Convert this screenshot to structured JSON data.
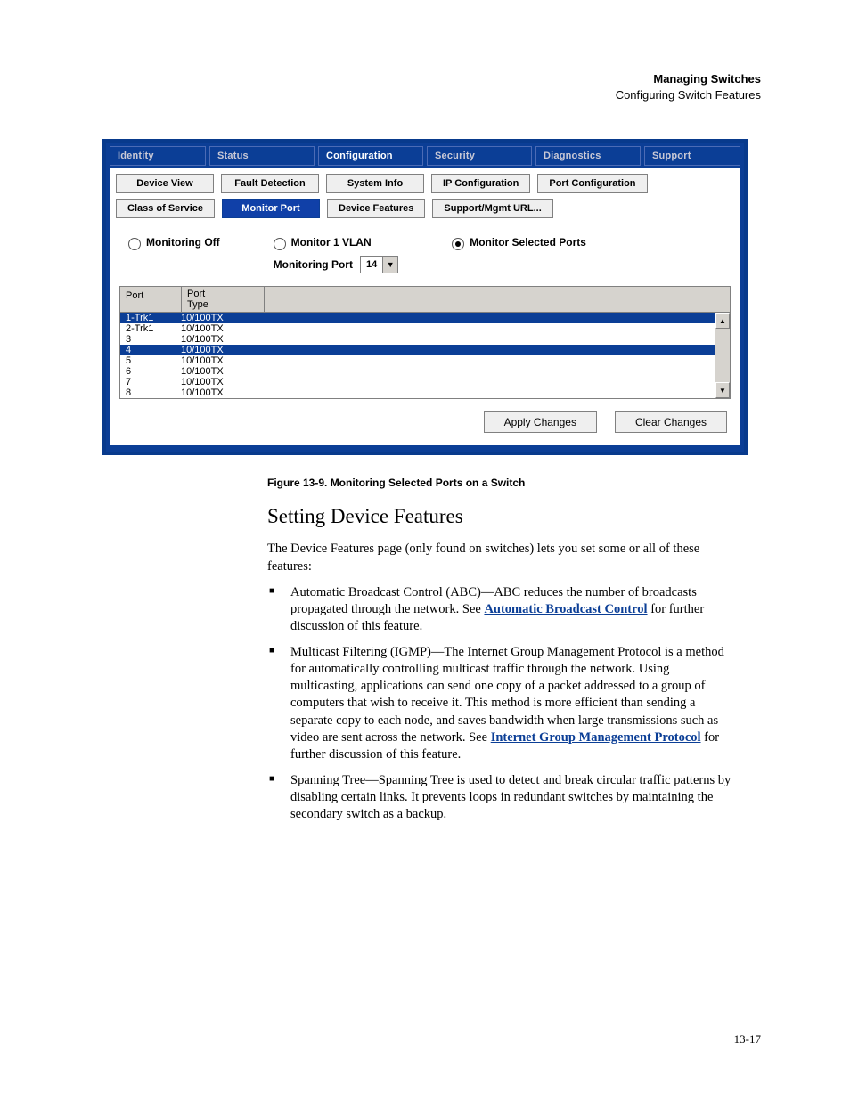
{
  "header": {
    "chapter": "Managing Switches",
    "section": "Configuring Switch Features"
  },
  "screenshot": {
    "main_tabs": [
      "Identity",
      "Status",
      "Configuration",
      "Security",
      "Diagnostics",
      "Support"
    ],
    "main_tab_selected": 2,
    "sub_tabs_row1": [
      "Device View",
      "Fault Detection",
      "System Info",
      "IP Configuration",
      "Port Configuration"
    ],
    "sub_tabs_row2": [
      "Class of Service",
      "Monitor Port",
      "Device Features",
      "Support/Mgmt URL..."
    ],
    "sub_tab_selected": "Monitor Port",
    "radios": {
      "off": "Monitoring Off",
      "vlan": "Monitor 1 VLAN",
      "ports": "Monitor Selected Ports",
      "selected": "ports",
      "monport_label": "Monitoring Port",
      "monport_value": "14"
    },
    "grid": {
      "col_port": "Port",
      "col_type": "Port\nType",
      "rows": [
        {
          "port": "1-Trk1",
          "type": "10/100TX",
          "sel": true
        },
        {
          "port": "2-Trk1",
          "type": "10/100TX",
          "sel": false
        },
        {
          "port": "3",
          "type": "10/100TX",
          "sel": false
        },
        {
          "port": "4",
          "type": "10/100TX",
          "sel": true
        },
        {
          "port": "5",
          "type": "10/100TX",
          "sel": false
        },
        {
          "port": "6",
          "type": "10/100TX",
          "sel": false
        },
        {
          "port": "7",
          "type": "10/100TX",
          "sel": false
        },
        {
          "port": "8",
          "type": "10/100TX",
          "sel": false
        }
      ]
    },
    "buttons": {
      "apply": "Apply Changes",
      "clear": "Clear Changes"
    }
  },
  "caption": "Figure 13-9.  Monitoring Selected Ports on a Switch",
  "section_title": "Setting Device Features",
  "intro": "The Device Features page (only found on switches) lets you set some or all of these features:",
  "bullets": {
    "b1a": "Automatic Broadcast Control (ABC)—ABC reduces the number of broadcasts propagated through the network. See ",
    "b1link": "Automatic Broadcast Control",
    "b1b": " for further discussion of this feature.",
    "b2a": "Multicast Filtering (IGMP)—The Internet Group Management Protocol is a method for automatically controlling multicast traffic through the network. Using multicasting, applications can send one copy of a packet addressed to a group of computers that wish to receive it. This method is more efficient than sending a separate copy to each node, and saves bandwidth when large transmissions such as video are sent across the network. See ",
    "b2link": "Internet Group Management Protocol",
    "b2b": " for further discussion of this feature.",
    "b3": "Spanning Tree—Spanning Tree is used to detect and break circular traffic patterns by disabling certain links. It prevents loops in redundant switches by maintaining the secondary switch as a backup."
  },
  "page_number": "13-17"
}
